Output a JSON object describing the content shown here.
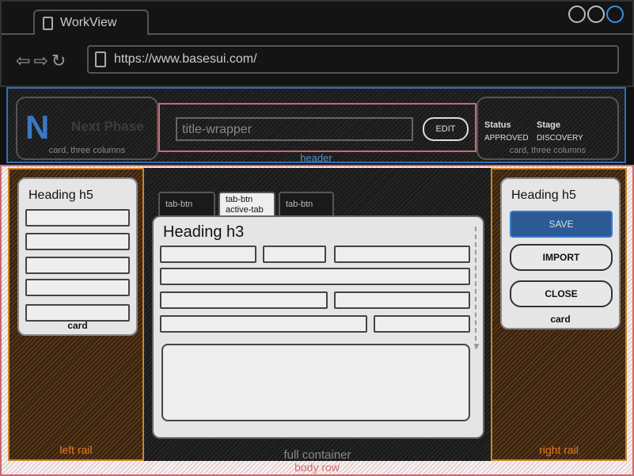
{
  "window": {
    "tab_title": "WorkView",
    "url": "https://www.basesui.com/"
  },
  "header": {
    "label": "header",
    "brand_logo": "N",
    "brand_name": "Next Phase",
    "left_card_label": "card, three columns",
    "title_placeholder": "title-wrapper",
    "edit_label": "EDIT",
    "status_heading": "Status",
    "status_value": "APPROVED",
    "stage_heading": "Stage",
    "stage_value": "DISCOVERY",
    "right_card_label": "card, three columns"
  },
  "left_rail": {
    "label": "left rail",
    "heading": "Heading h5",
    "card_label": "card"
  },
  "center": {
    "tabs": [
      {
        "label": "tab-btn"
      },
      {
        "label_line1": "tab-btn",
        "label_line2": "active-tab"
      },
      {
        "label": "tab-btn"
      }
    ],
    "heading": "Heading h3",
    "container_label": "full container"
  },
  "right_rail": {
    "label": "right rail",
    "heading": "Heading h5",
    "buttons": {
      "save": "SAVE",
      "import": "IMPORT",
      "close": "CLOSE"
    },
    "card_label": "card"
  },
  "body_row_label": "body row",
  "colors": {
    "header_border": "#2f6fb0",
    "body_row_border": "#c86a74",
    "rail_border": "#c7852a",
    "primary_button": "#2b5a95"
  },
  "icons": [
    "document-icon",
    "back-arrow-icon",
    "forward-arrow-icon",
    "refresh-icon",
    "window-control-icon",
    "scroll-down-icon"
  ]
}
